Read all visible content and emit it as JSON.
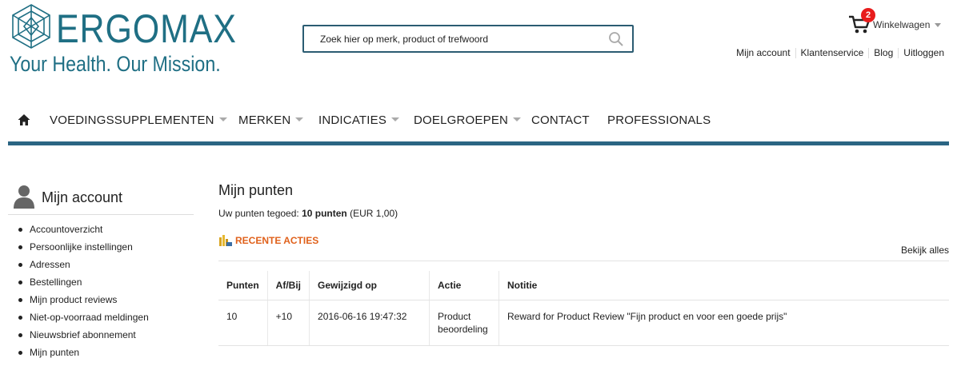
{
  "header": {
    "logo_word": "ERGOMAX",
    "logo_tagline": "Your Health. Our Mission.",
    "search": {
      "placeholder": "Zoek hier op merk, product of trefwoord",
      "icon": "search-icon"
    },
    "cart": {
      "label": "Winkelwagen",
      "count": "2",
      "icon": "cart-icon"
    },
    "top_links": [
      "Mijn account",
      "Klantenservice",
      "Blog",
      "Uitloggen"
    ]
  },
  "nav": {
    "home_icon": "home-icon",
    "items": [
      {
        "label": "VOEDINGSSUPPLEMENTEN",
        "dropdown": true
      },
      {
        "label": "MERKEN",
        "dropdown": true
      },
      {
        "label": "INDICATIES",
        "dropdown": true
      },
      {
        "label": "DOELGROEPEN",
        "dropdown": true
      },
      {
        "label": "CONTACT",
        "dropdown": false
      },
      {
        "label": "PROFESSIONALS",
        "dropdown": false
      }
    ],
    "bar_color": "#2b6583"
  },
  "sidebar": {
    "title": "Mijn account",
    "icon": "user-icon",
    "items": [
      "Accountoverzicht",
      "Persoonlijke instellingen",
      "Adressen",
      "Bestellingen",
      "Mijn product reviews",
      "Niet-op-voorraad meldingen",
      "Nieuwsbrief abonnement",
      "Mijn punten"
    ]
  },
  "main": {
    "title": "Mijn punten",
    "balance_label": "Uw punten tegoed:",
    "balance_points": "10 punten",
    "balance_money": "(EUR  1,00)",
    "recent_label": "RECENTE ACTIES",
    "recent_icon": "coins-icon",
    "view_all": "Bekijk alles",
    "table": {
      "headers": [
        "Punten",
        "Af/Bij",
        "Gewijzigd op",
        "Actie",
        "Notitie"
      ],
      "rows": [
        [
          "10",
          "+10",
          "2016-06-16 19:47:32",
          "Product beoordeling",
          "Reward for Product Review \"Fijn product en voor een goede prijs\""
        ]
      ]
    }
  },
  "colors": {
    "brand": "#1f6f84",
    "accent": "#e0611b",
    "badge": "#e81c1c"
  }
}
